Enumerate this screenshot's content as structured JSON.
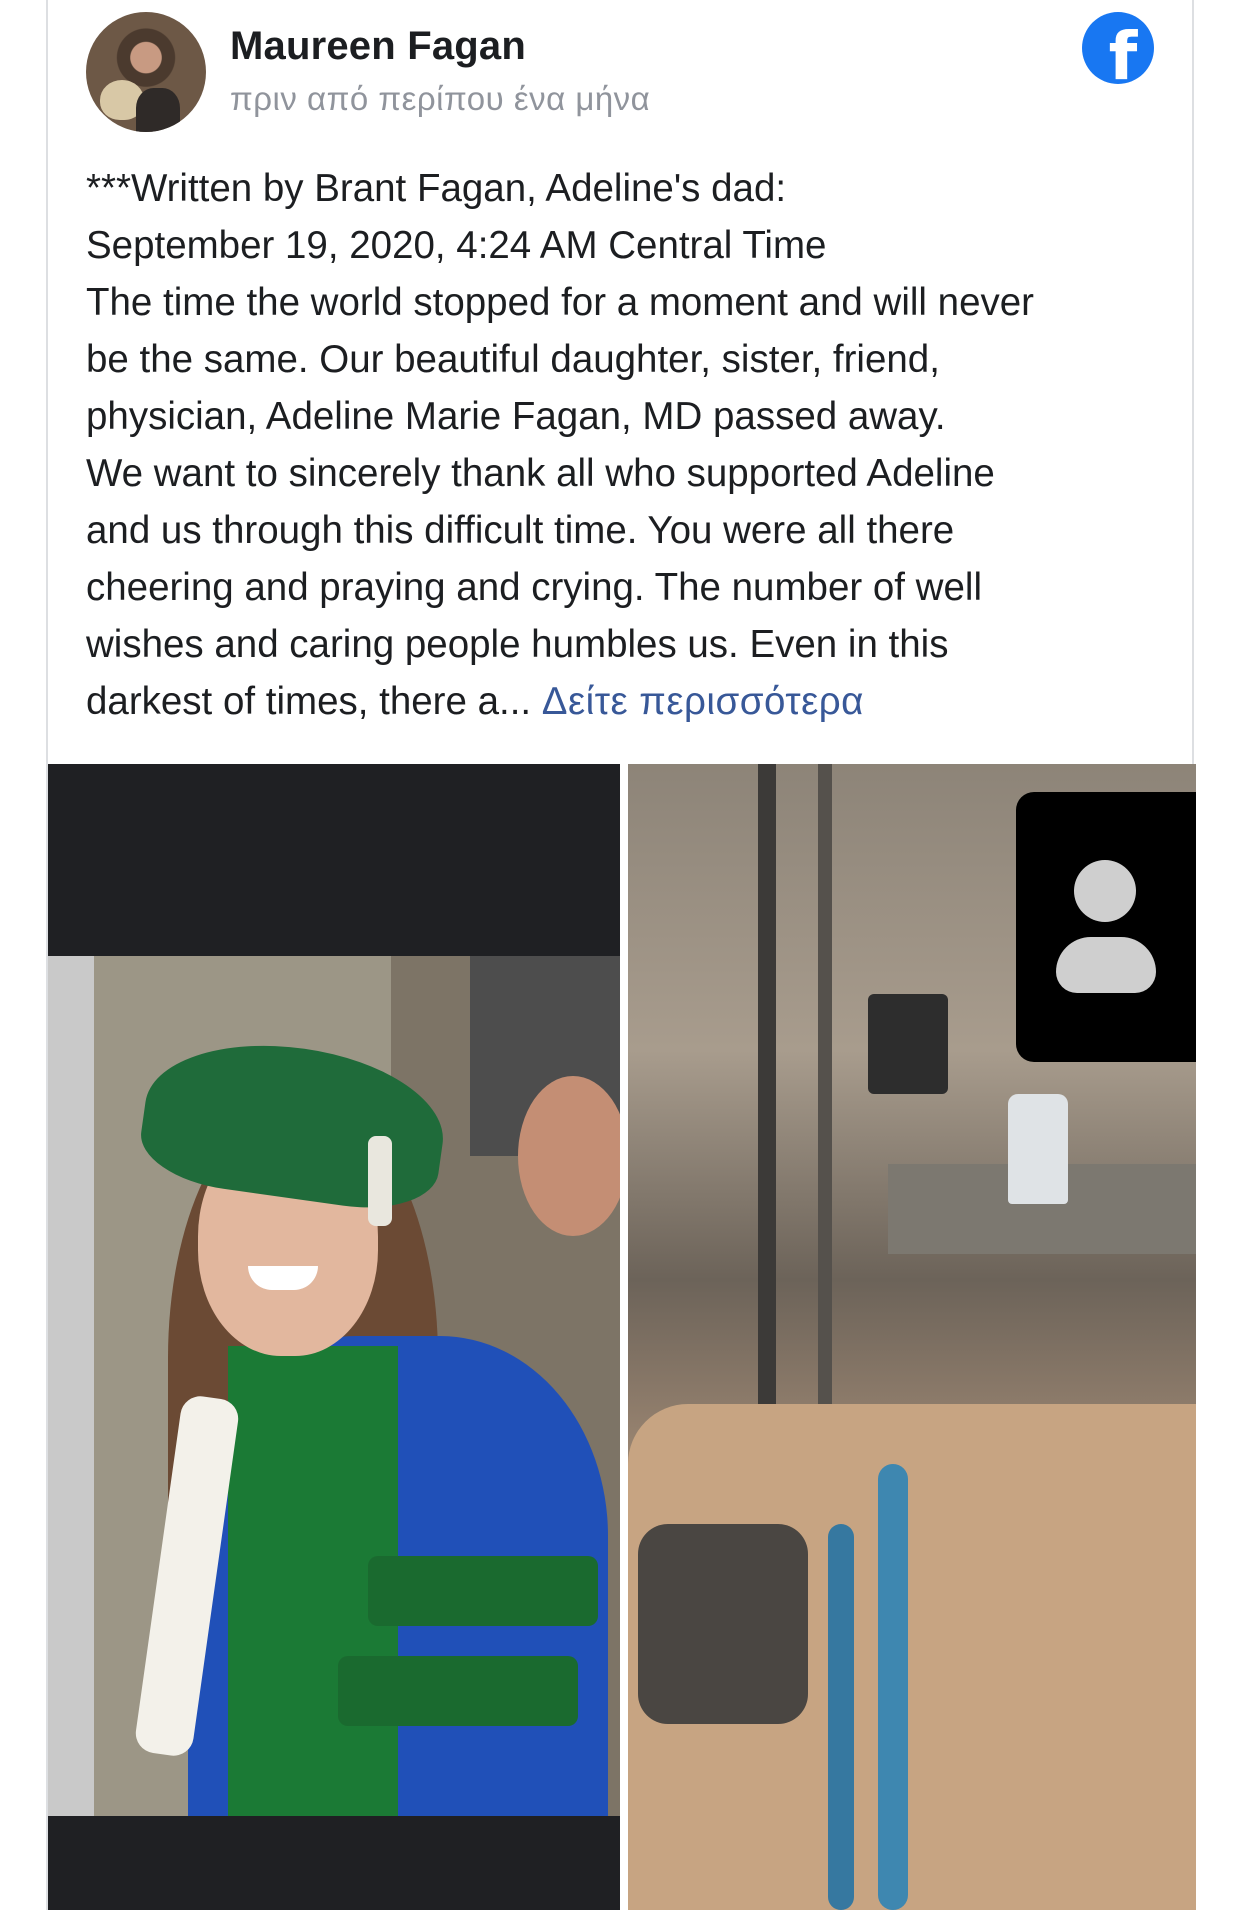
{
  "post": {
    "author": "Maureen Fagan",
    "timestamp": "πριν από περίπου ένα μήνα",
    "platform_icon": "facebook-icon",
    "brand_color": "#1877f2",
    "lines": [
      "***Written by Brant Fagan, Adeline's dad:",
      "September 19, 2020, 4:24 AM Central Time",
      "The time the world stopped for a moment and will never",
      "be the same. Our beautiful daughter, sister, friend,",
      "physician, Adeline Marie Fagan, MD passed away.",
      "We want to sincerely thank all who supported Adeline",
      "and us through this difficult time. You were all there",
      "cheering and praying and crying. The number of well",
      "wishes and caring people humbles us. Even in this"
    ],
    "last_line": "darkest of times, there a...",
    "see_more": "Δείτε περισσότερα",
    "see_more_color": "#385898"
  },
  "photos": {
    "left": "graduation-photo",
    "right": "hospital-photo",
    "overlay": "video-call-participant-icon"
  }
}
